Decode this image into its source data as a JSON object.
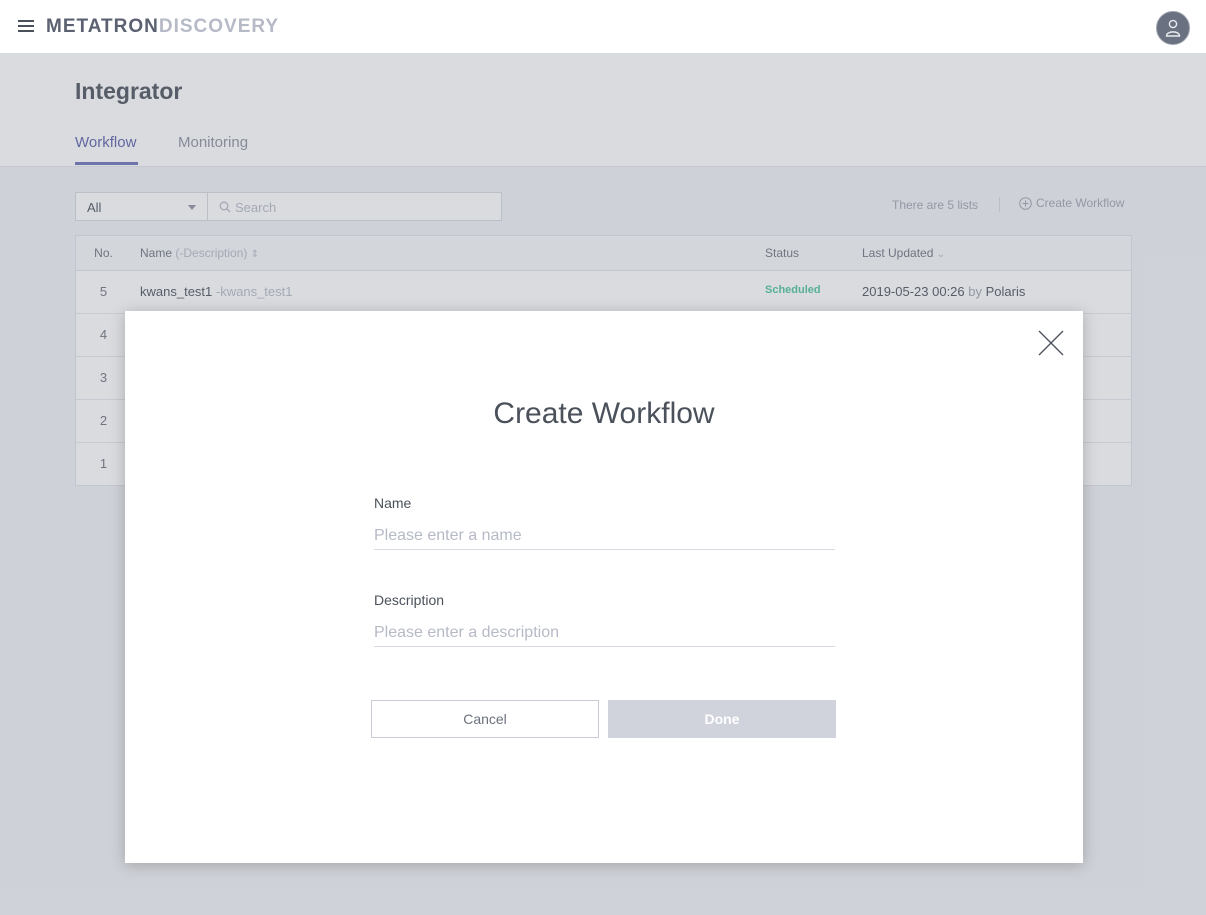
{
  "app": {
    "logo_primary": "METATRON",
    "logo_secondary": "DISCOVERY"
  },
  "header": {
    "title": "Integrator",
    "tabs": [
      {
        "label": "Workflow",
        "active": true
      },
      {
        "label": "Monitoring",
        "active": false
      }
    ]
  },
  "toolbar": {
    "filter_selected": "All",
    "search_placeholder": "Search",
    "list_count": "There are 5 lists",
    "create_label": "Create Workflow"
  },
  "table": {
    "columns": {
      "no": "No.",
      "name": "Name",
      "description_hint": "(-Description)",
      "status": "Status",
      "last_updated": "Last Updated"
    },
    "rows": [
      {
        "no": "5",
        "name": "kwans_test1",
        "description": "-kwans_test1",
        "status": "Scheduled",
        "date": "2019-05-23 00:26",
        "by": "by",
        "user": "Polaris"
      },
      {
        "no": "4"
      },
      {
        "no": "3"
      },
      {
        "no": "2"
      },
      {
        "no": "1"
      }
    ]
  },
  "modal": {
    "title": "Create Workflow",
    "name_label": "Name",
    "name_placeholder": "Please enter a name",
    "description_label": "Description",
    "description_placeholder": "Please enter a description",
    "cancel_label": "Cancel",
    "done_label": "Done"
  },
  "colors": {
    "accent": "#6b70b8",
    "status_scheduled": "#4cc49a",
    "done_disabled": "#d1d3dc"
  }
}
